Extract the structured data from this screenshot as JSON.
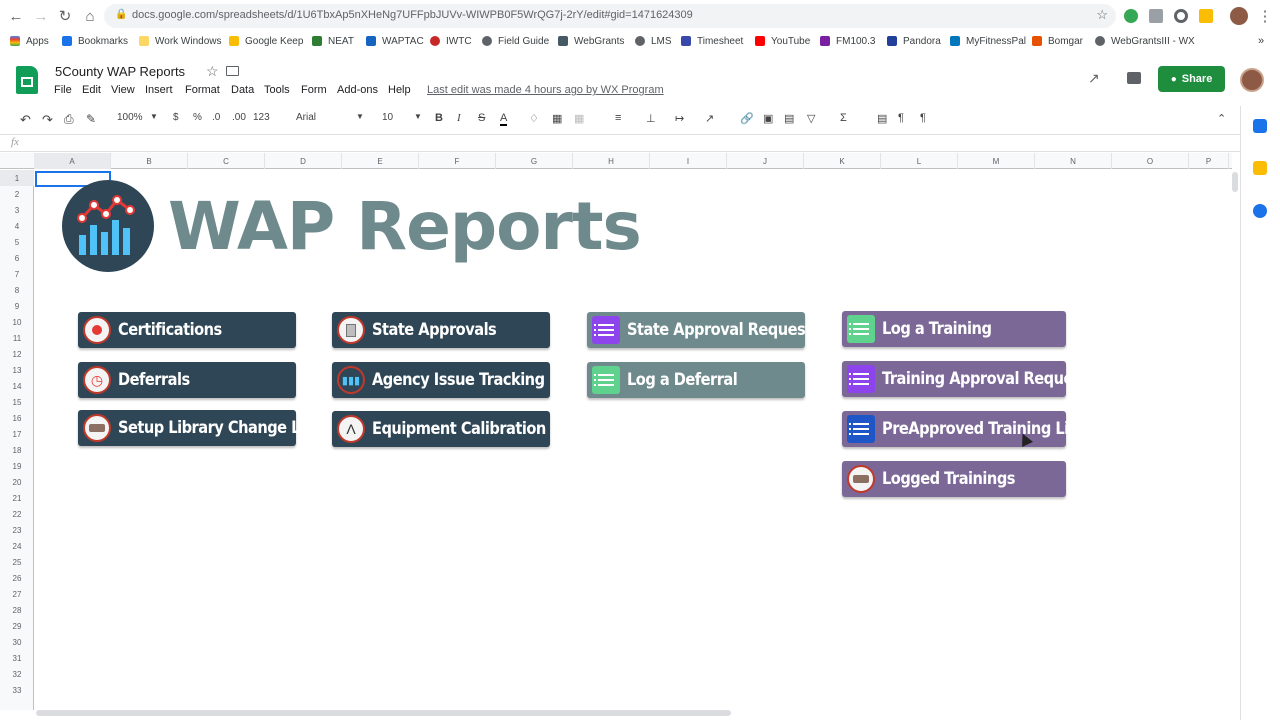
{
  "browser": {
    "url": "docs.google.com/spreadsheets/d/1U6TbxAp5nXHeNg7UFFpbJUVv-WIWPB0F5WrQG7j-2rY/edit#gid=1471624309",
    "bookmarks": [
      "Apps",
      "Bookmarks",
      "Work Windows",
      "Google Keep",
      "NEAT",
      "WAPTAC",
      "IWTC",
      "Field Guide",
      "WebGrants",
      "LMS",
      "Timesheet",
      "YouTube",
      "FM100.3",
      "Pandora",
      "MyFitnessPal",
      "Bomgar",
      "WebGrantsIII - WX"
    ]
  },
  "sheet": {
    "title": "5County WAP Reports",
    "menu": [
      "File",
      "Edit",
      "View",
      "Insert",
      "Format",
      "Data",
      "Tools",
      "Form",
      "Add-ons",
      "Help"
    ],
    "last_edit": "Last edit was made 4 hours ago by WX Program",
    "share_label": "Share",
    "zoom": "100%",
    "font": "Arial",
    "font_size": "10",
    "currency": "$",
    "percent": "%",
    "dec_less": ".0",
    "dec_more": ".00",
    "more_formats": "123",
    "fx": "fx",
    "columns": [
      "A",
      "B",
      "C",
      "D",
      "E",
      "F",
      "G",
      "H",
      "I",
      "J",
      "K",
      "L",
      "M",
      "N",
      "O",
      "P"
    ],
    "rows": [
      "1",
      "2",
      "3",
      "4",
      "5",
      "6",
      "7",
      "8",
      "9",
      "10",
      "11",
      "12",
      "13",
      "14",
      "15",
      "16",
      "17",
      "18",
      "19",
      "20",
      "21",
      "22",
      "23",
      "24",
      "25",
      "26",
      "27",
      "28",
      "29",
      "30",
      "31",
      "32",
      "33"
    ]
  },
  "content": {
    "heading": "WAP Reports",
    "buttons": {
      "certifications": "Certifications",
      "deferrals": "Deferrals",
      "setup_library": "Setup Library Change Log",
      "state_approvals": "State Approvals",
      "agency_issue": "Agency Issue Tracking",
      "equipment": "Equipment Calibration",
      "state_approval_request": "State Approval Request",
      "log_deferral": "Log a Deferral",
      "log_training": "Log  a Training",
      "training_approval": "Training Approval Request",
      "preapproved": "PreApproved Training List",
      "logged_trainings": "Logged Trainings"
    }
  },
  "colors": {
    "dark_button": "#2e4656",
    "grey_button": "#6f8a8c",
    "purple_button": "#7b6897",
    "share_green": "#1e8e3e"
  }
}
